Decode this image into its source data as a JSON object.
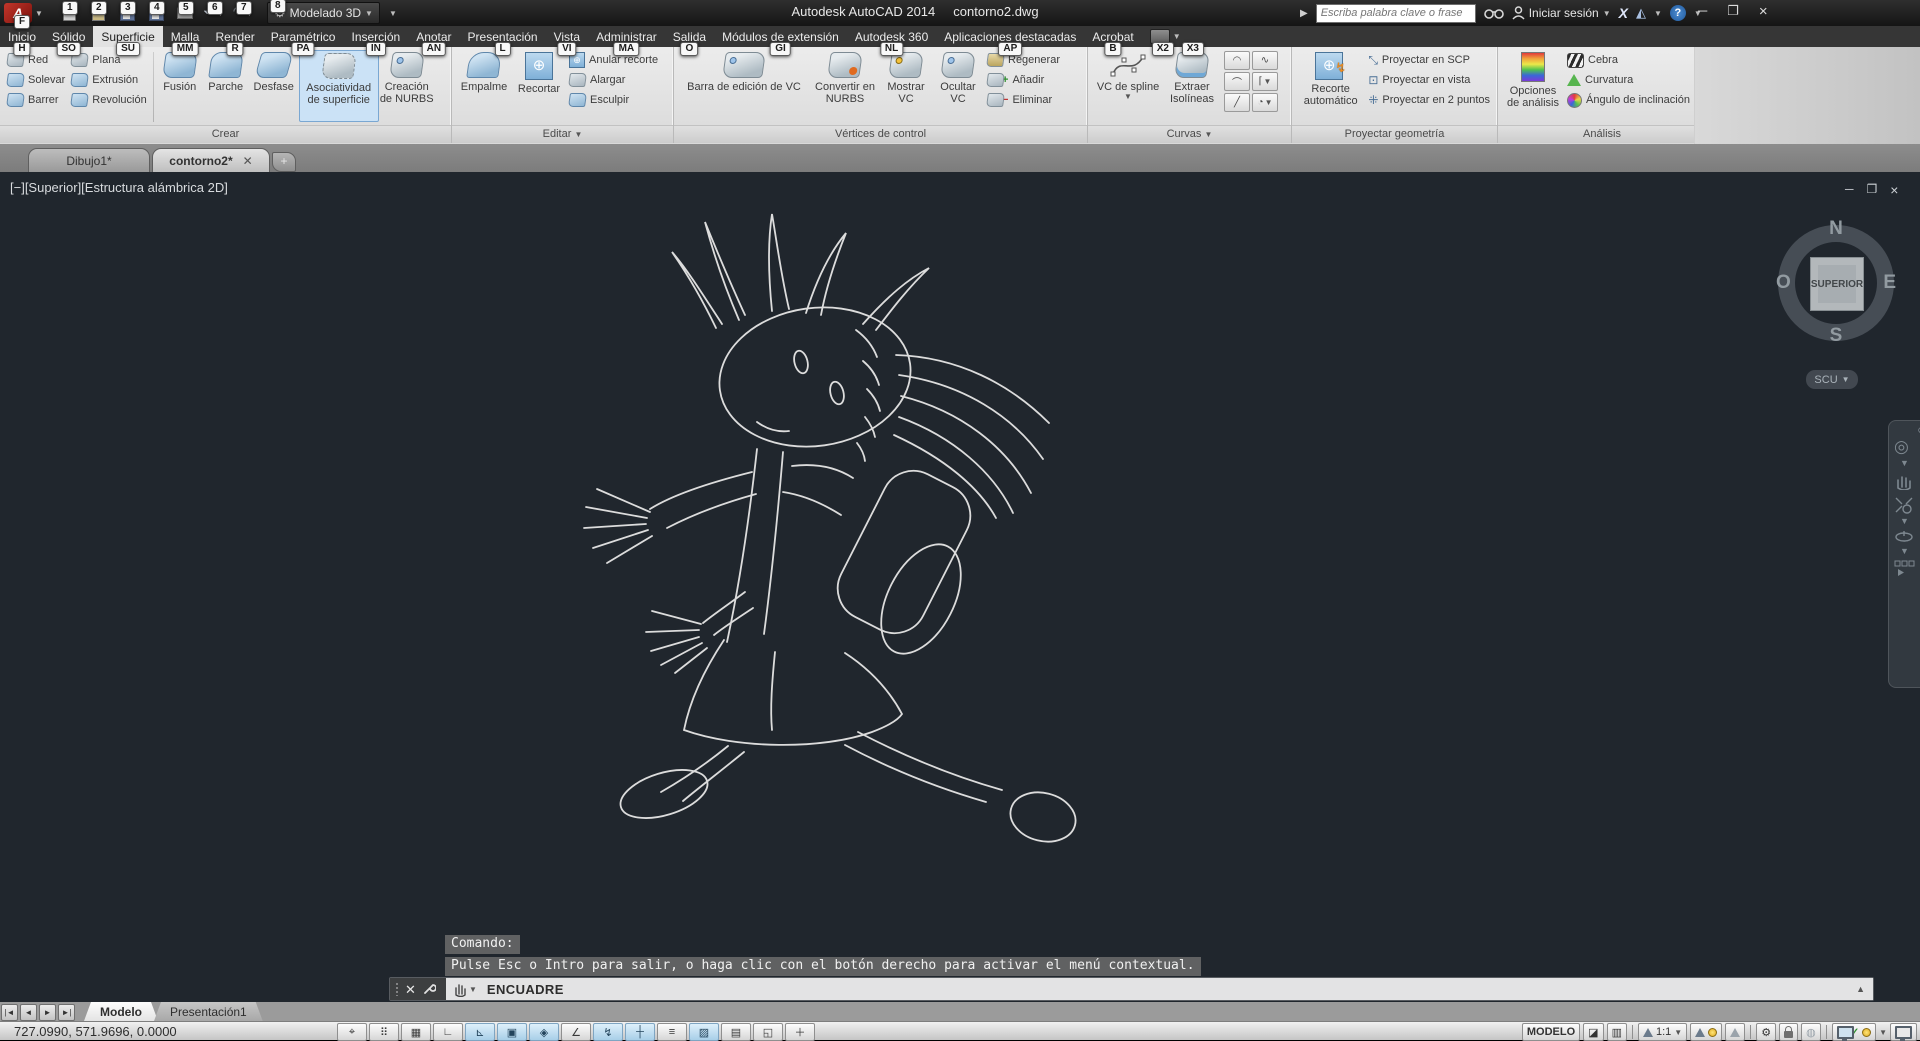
{
  "titlebar": {
    "app_keytip": "F",
    "qat_keytips": [
      "1",
      "2",
      "3",
      "4",
      "5",
      "6",
      "7"
    ],
    "workspace_keytip": "8",
    "workspace": "Modelado 3D",
    "app_title": "Autodesk AutoCAD 2014",
    "doc_title": "contorno2.dwg",
    "search_placeholder": "Escriba palabra clave o frase",
    "signin": "Iniciar sesión"
  },
  "ribbon": {
    "tabs": [
      {
        "label": "Inicio",
        "keytip": "H"
      },
      {
        "label": "Sólido",
        "keytip": "SO"
      },
      {
        "label": "Superficie",
        "keytip": "SU",
        "active": true
      },
      {
        "label": "Malla",
        "keytip": "MM"
      },
      {
        "label": "Render",
        "keytip": "R"
      },
      {
        "label": "Paramétrico",
        "keytip": "PA"
      },
      {
        "label": "Inserción",
        "keytip": "IN"
      },
      {
        "label": "Anotar",
        "keytip": "AN"
      },
      {
        "label": "Presentación",
        "keytip": "L"
      },
      {
        "label": "Vista",
        "keytip": "VI"
      },
      {
        "label": "Administrar",
        "keytip": "MA"
      },
      {
        "label": "Salida",
        "keytip": "O"
      },
      {
        "label": "Módulos de extensión",
        "keytip": "GI"
      },
      {
        "label": "Autodesk 360",
        "keytip": "NL"
      },
      {
        "label": "Aplicaciones destacadas",
        "keytip": "AP"
      },
      {
        "label": "Acrobat",
        "keytip": "B"
      }
    ],
    "overflow_keytips": [
      "X2",
      "X3"
    ],
    "panels": [
      {
        "label": "Crear"
      },
      {
        "label": "Editar"
      },
      {
        "label": "Vértices de control"
      },
      {
        "label": "Curvas"
      },
      {
        "label": "Proyectar geometría"
      },
      {
        "label": "Análisis"
      }
    ],
    "crear": {
      "red": "Red",
      "plana": "Plana",
      "solevar": "Solevar",
      "extrusion": "Extrusión",
      "barrer": "Barrer",
      "revolucion": "Revolución",
      "fusion": "Fusión",
      "parche": "Parche",
      "desfase": "Desfase",
      "asociatividad": "Asociatividad de superficie",
      "nurbs": "Creación de NURBS"
    },
    "editar": {
      "empalme": "Empalme",
      "recortar": "Recortar",
      "anular": "Anular recorte",
      "alargar": "Alargar",
      "esculpir": "Esculpir"
    },
    "vertices": {
      "barra": "Barra de edición de VC",
      "convertir": "Convertir en NURBS",
      "mostrar": "Mostrar VC",
      "ocultar": "Ocultar VC",
      "regenerar": "Regenerar",
      "anadir": "Añadir",
      "eliminar": "Eliminar"
    },
    "curvas": {
      "spline": "VC de spline",
      "extraer": "Extraer Isolíneas"
    },
    "proyectar": {
      "recorte": "Recorte automático",
      "scp": "Proyectar en SCP",
      "vista": "Proyectar en vista",
      "puntos": "Proyectar en 2 puntos"
    },
    "analisis": {
      "opciones": "Opciones de análisis",
      "cebra": "Cebra",
      "curvatura": "Curvatura",
      "angulo": "Ángulo de inclinación"
    }
  },
  "doctabs": {
    "t1": "Dibujo1*",
    "t2": "contorno2*"
  },
  "viewport": {
    "label": "[−][Superior][Estructura alámbrica 2D]",
    "viewcube": {
      "n": "N",
      "s": "S",
      "e": "E",
      "o": "O",
      "face": "SUPERIOR",
      "scu": "SCU"
    },
    "history1": "Comando:",
    "history2": "Pulse Esc o Intro para salir, o haga clic con el botón derecho para activar el menú contextual.",
    "command": "ENCUADRE"
  },
  "layouttabs": {
    "modelo": "Modelo",
    "pres": "Presentación1"
  },
  "statusbar": {
    "coords": "727.0990, 571.9696, 0.0000",
    "modelo": "MODELO",
    "scale": "1:1"
  }
}
